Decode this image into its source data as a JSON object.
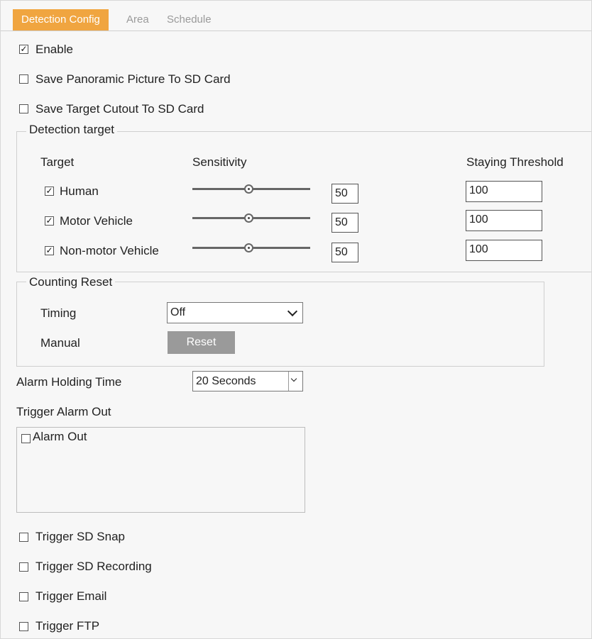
{
  "tabs": [
    {
      "label": "Detection Config",
      "active": true
    },
    {
      "label": "Area",
      "active": false
    },
    {
      "label": "Schedule",
      "active": false
    }
  ],
  "options": {
    "enable": {
      "label": "Enable",
      "checked": true
    },
    "save_panoramic": {
      "label": "Save Panoramic Picture To SD Card",
      "checked": false
    },
    "save_cutout": {
      "label": "Save Target Cutout To SD Card",
      "checked": false
    }
  },
  "detection_target": {
    "legend": "Detection target",
    "col_target": "Target",
    "col_sensitivity": "Sensitivity",
    "col_threshold": "Staying Threshold",
    "rows": [
      {
        "label": "Human",
        "checked": true,
        "sensitivity": "50",
        "threshold": "100"
      },
      {
        "label": "Motor Vehicle",
        "checked": true,
        "sensitivity": "50",
        "threshold": "100"
      },
      {
        "label": "Non-motor Vehicle",
        "checked": true,
        "sensitivity": "50",
        "threshold": "100"
      }
    ]
  },
  "counting_reset": {
    "legend": "Counting Reset",
    "timing_label": "Timing",
    "timing_value": "Off",
    "manual_label": "Manual",
    "reset_button": "Reset"
  },
  "alarm": {
    "holding_label": "Alarm Holding Time",
    "holding_value": "20 Seconds",
    "trigger_out_label": "Trigger Alarm Out",
    "alarm_out": {
      "label": "Alarm Out",
      "checked": false
    }
  },
  "triggers": [
    {
      "label": "Trigger SD Snap",
      "checked": false
    },
    {
      "label": "Trigger SD Recording",
      "checked": false
    },
    {
      "label": "Trigger Email",
      "checked": false
    },
    {
      "label": "Trigger FTP",
      "checked": false
    }
  ],
  "colors": {
    "accent": "#f0a540",
    "button": "#9a9a9a"
  }
}
